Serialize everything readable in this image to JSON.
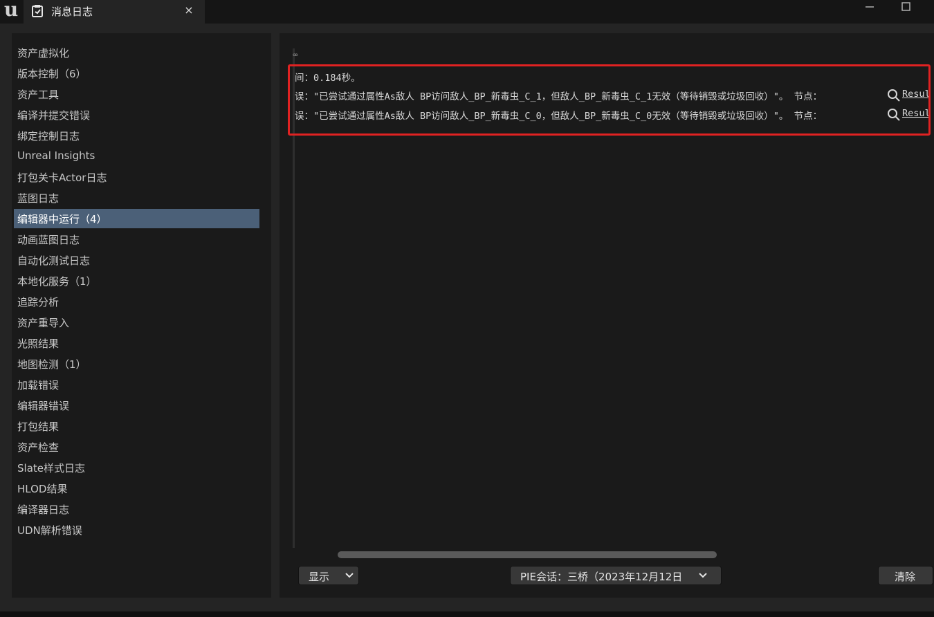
{
  "app": {
    "logo": "UE-logo-icon"
  },
  "tab": {
    "title": "消息日志",
    "close": "×"
  },
  "sidebar": {
    "items": [
      {
        "label": "资产虚拟化"
      },
      {
        "label": "版本控制（6）"
      },
      {
        "label": "资产工具"
      },
      {
        "label": "编译并提交错误"
      },
      {
        "label": "绑定控制日志"
      },
      {
        "label": "Unreal Insights"
      },
      {
        "label": "打包关卡Actor日志"
      },
      {
        "label": "蓝图日志"
      },
      {
        "label": "编辑器中运行（4）",
        "selected": true
      },
      {
        "label": "动画蓝图日志"
      },
      {
        "label": "自动化测试日志"
      },
      {
        "label": "本地化服务（1）"
      },
      {
        "label": "追踪分析"
      },
      {
        "label": "资产重导入"
      },
      {
        "label": "光照结果"
      },
      {
        "label": "地图检测（1）"
      },
      {
        "label": "加载错误"
      },
      {
        "label": "编辑器错误"
      },
      {
        "label": "打包结果"
      },
      {
        "label": "资产检查"
      },
      {
        "label": "Slate样式日志"
      },
      {
        "label": "HLOD结果"
      },
      {
        "label": "编译器日志"
      },
      {
        "label": "UDN解析错误"
      }
    ]
  },
  "log": {
    "fragment": "ꟹ",
    "lines": [
      "间：0.184秒。",
      "误：\"已尝试通过属性As敌人 BP访问敌人_BP_新毒虫_C_1，但敌人_BP_新毒虫_C_1无效（等待销毁或垃圾回收）\"。 节点：",
      "误：\"已尝试通过属性As敌人 BP访问敌人_BP_新毒虫_C_0，但敌人_BP_新毒虫_C_0无效（等待销毁或垃圾回收）\"。 节点："
    ],
    "result_link": "Resul",
    "highlight_color": "#e02222"
  },
  "footer": {
    "show_label": "显示",
    "session_label": "PIE会话：三桥（2023年12月12日",
    "clear_label": "清除"
  },
  "colors": {
    "selected_bg": "#4b6078",
    "panel_bg": "#1a1a1a",
    "window_bg": "#242424"
  }
}
